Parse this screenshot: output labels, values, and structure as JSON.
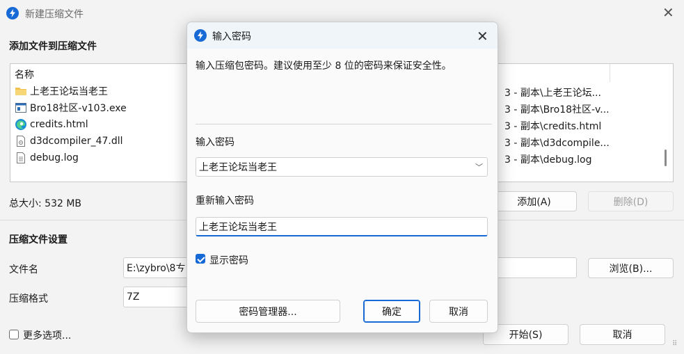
{
  "main_window": {
    "title": "新建压缩文件",
    "add_section_title": "添加文件到压缩文件",
    "column_name": "名称",
    "files": [
      {
        "name": "上老王论坛当老王",
        "icon": "folder-icon",
        "path": "3 - 副本\\上老王论坛..."
      },
      {
        "name": "Bro18社区-v103.exe",
        "icon": "exe-icon",
        "path": "3 - 副本\\Bro18社区-v..."
      },
      {
        "name": "credits.html",
        "icon": "edge-browser-icon",
        "path": "3 - 副本\\credits.html"
      },
      {
        "name": "d3dcompiler_47.dll",
        "icon": "dll-file-icon",
        "path": "3 - 副本\\d3dcompile..."
      },
      {
        "name": "debug.log",
        "icon": "text-file-icon",
        "path": "3 - 副本\\debug.log"
      }
    ],
    "total_size": "总大小: 532 MB",
    "add_button": "添加(A)",
    "delete_button": "删除(D)",
    "settings_title": "压缩文件设置",
    "filename_label": "文件名",
    "filename_value": "E:\\zybro\\8ㄘ",
    "browse_button": "浏览(B)...",
    "format_label": "压缩格式",
    "format_value": "7Z",
    "more_options_label": "更多选项...",
    "start_button": "开始(S)",
    "cancel_button": "取消"
  },
  "dialog": {
    "title": "输入密码",
    "description": "输入压缩包密码。建议使用至少 8 位的密码来保证安全性。",
    "password_label": "输入密码",
    "password_value": "上老王论坛当老王",
    "reenter_label": "重新输入密码",
    "reenter_value": "上老王论坛当老王",
    "show_password_label": "显示密码",
    "show_password_checked": true,
    "password_manager_button": "密码管理器...",
    "ok_button": "确定",
    "cancel_button": "取消"
  },
  "colors": {
    "accent": "#1769d6",
    "window_bg": "#f3f3f3",
    "dialog_titlebar": "#f0f5fa"
  }
}
